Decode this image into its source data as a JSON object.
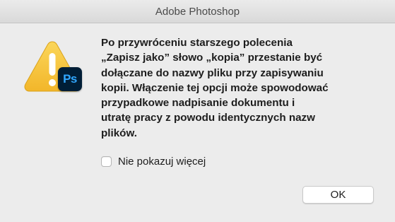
{
  "window": {
    "title": "Adobe Photoshop"
  },
  "icons": {
    "warning": "warning-triangle-icon",
    "app": "photoshop-app-icon",
    "app_text": "Ps",
    "colors": {
      "warning_yellow": "#f6c23b",
      "warning_exclamation": "#ffffff",
      "ps_background": "#001e36",
      "ps_text": "#31a8ff"
    }
  },
  "message": {
    "text": "Po przywróceniu starszego polecenia\n„Zapisz jako” słowo „kopia” przestanie być\ndołączane do nazwy pliku przy zapisywaniu\nkopii. Włączenie tej opcji może spowodować\nprzypadkowe nadpisanie dokumentu i\nutratę pracy z powodu identycznych nazw\nplików."
  },
  "checkbox": {
    "label": "Nie pokazuj więcej",
    "checked": false
  },
  "buttons": {
    "ok_label": "OK"
  }
}
